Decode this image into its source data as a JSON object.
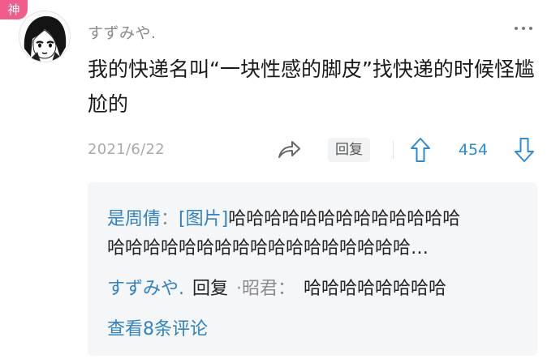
{
  "badge": {
    "label": "神"
  },
  "post": {
    "username": "すずみや.",
    "content": "我的快递名叫“一块性感的脚皮”找快递的时候怪尴尬的",
    "date": "2021/6/22",
    "reply_label": "回复",
    "vote_count": "454"
  },
  "subcomments": {
    "first": {
      "author": "是周倩",
      "colon": "：",
      "image_tag": "[图片]",
      "text_line1": "哈哈哈哈哈哈哈哈哈哈哈哈哈",
      "text_line2": "哈哈哈哈哈哈哈哈哈哈哈哈哈哈哈哈哈…"
    },
    "second": {
      "author": "すずみや.",
      "reply_word": "回复",
      "target": "·昭君",
      "colon": "：",
      "text": "哈哈哈哈哈哈哈哈"
    },
    "view_all": "查看8条评论"
  },
  "icons": {
    "more": "more-dots-icon",
    "share": "share-arrow-icon",
    "upvote": "upvote-arrow-icon",
    "downvote": "downvote-arrow-icon"
  },
  "colors": {
    "badge": "#f05d8a",
    "link": "#2f82c4",
    "vote": "#2c8bd8",
    "sub_bg": "#f5f6f8"
  }
}
